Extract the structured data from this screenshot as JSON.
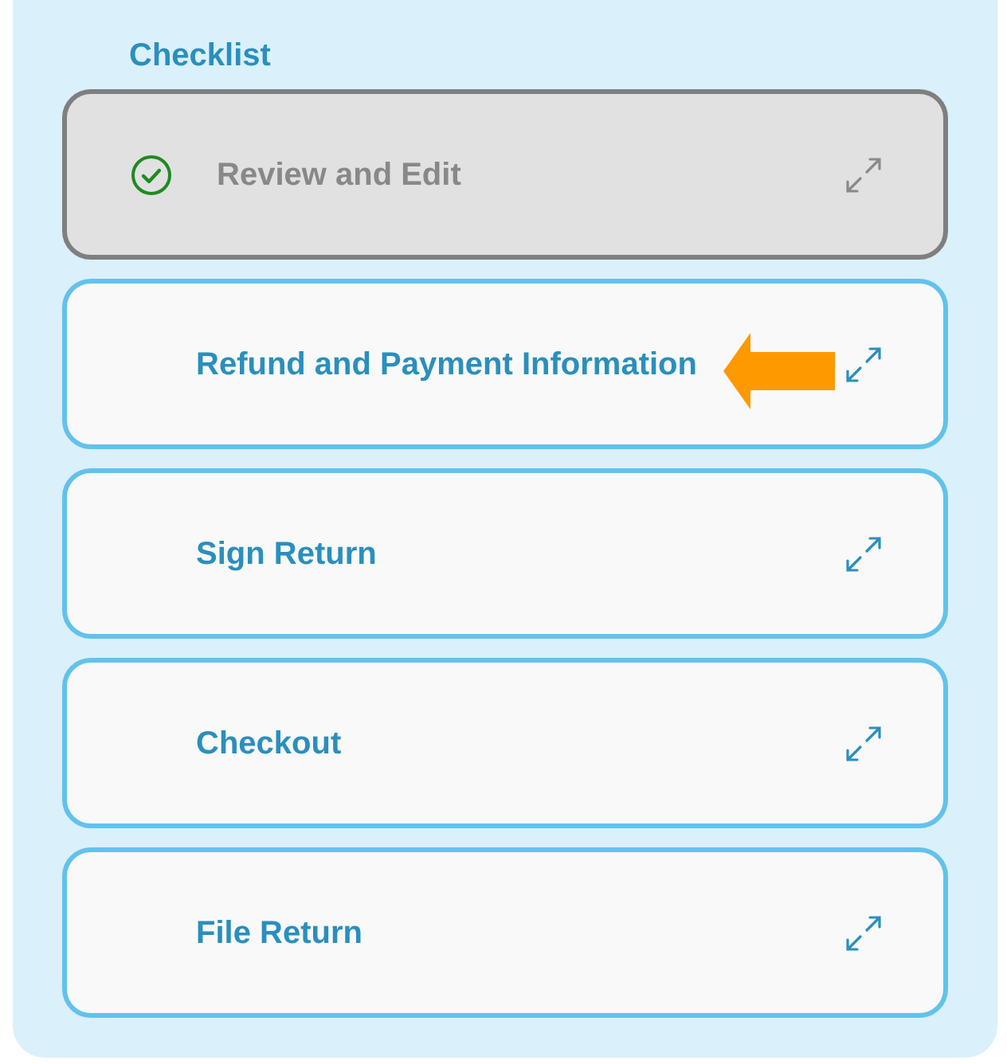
{
  "title": "Checklist",
  "items": [
    {
      "label": "Review and Edit",
      "completed": true,
      "pointer": false
    },
    {
      "label": "Refund and Payment Information",
      "completed": false,
      "pointer": true
    },
    {
      "label": "Sign Return",
      "completed": false,
      "pointer": false
    },
    {
      "label": "Checkout",
      "completed": false,
      "pointer": false
    },
    {
      "label": "File Return",
      "completed": false,
      "pointer": false
    }
  ]
}
